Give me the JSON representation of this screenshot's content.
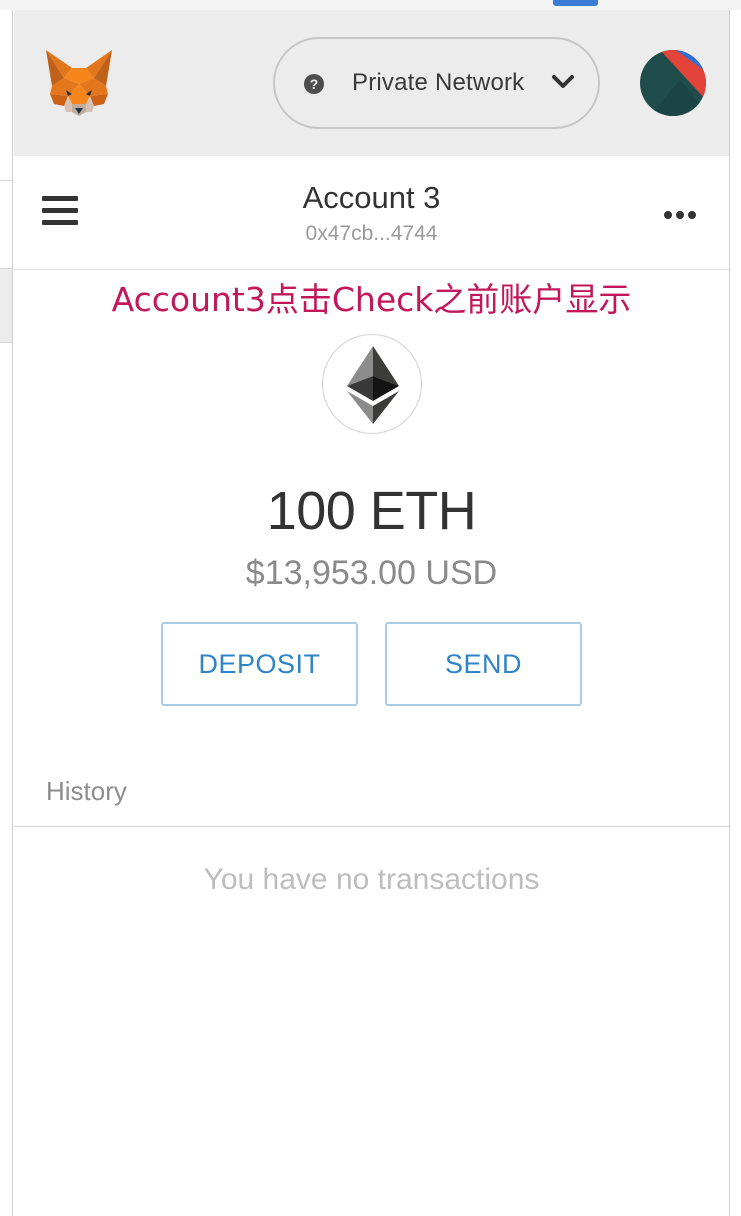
{
  "header": {
    "network": {
      "help_symbol": "?",
      "label": "Private Network"
    },
    "colors": {
      "header_bg": "#ececec",
      "identicon": [
        "#1e4d4c",
        "#e2443a",
        "#2f6fd6"
      ]
    }
  },
  "account": {
    "name": "Account 3",
    "address": "0x47cb...4744"
  },
  "annotation": "Account3点击Check之前账户显示",
  "wallet": {
    "balance": "100 ETH",
    "balance_usd": "$13,953.00 USD",
    "deposit_label": "DEPOSIT",
    "send_label": "SEND"
  },
  "history": {
    "label": "History",
    "empty_text": "You have no transactions"
  },
  "colors": {
    "accent": "#2f83c9",
    "annotation": "#c2185b",
    "button_border": "#a9cde6"
  }
}
